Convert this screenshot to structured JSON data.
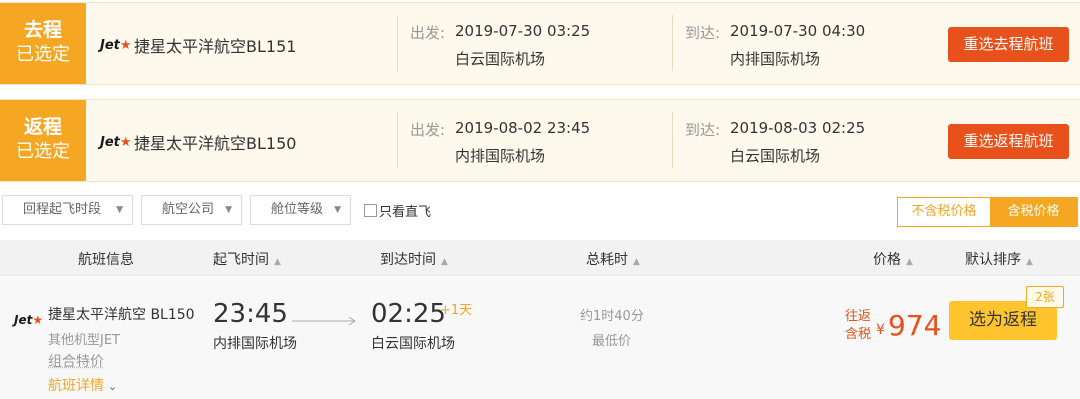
{
  "segments": [
    {
      "tag_line1": "去程",
      "tag_line2": "已选定",
      "logo_text": "Jet",
      "logo_star": "★",
      "airline_flight": "捷星太平洋航空BL151",
      "dep_label": "出发:",
      "dep_time": "2019-07-30 03:25",
      "dep_airport": "白云国际机场",
      "arr_label": "到达:",
      "arr_time": "2019-07-30 04:30",
      "arr_airport": "内排国际机场",
      "reselect_label": "重选去程航班"
    },
    {
      "tag_line1": "返程",
      "tag_line2": "已选定",
      "logo_text": "Jet",
      "logo_star": "★",
      "airline_flight": "捷星太平洋航空BL150",
      "dep_label": "出发:",
      "dep_time": "2019-08-02 23:45",
      "dep_airport": "内排国际机场",
      "arr_label": "到达:",
      "arr_time": "2019-08-03 02:25",
      "arr_airport": "白云国际机场",
      "reselect_label": "重选返程航班"
    }
  ],
  "filters": {
    "time_segment": "回程起飞时段",
    "airline": "航空公司",
    "cabin": "舱位等级",
    "direct_only": "只看直飞",
    "tax_excluded": "不含税价格",
    "tax_included": "含税价格"
  },
  "table_headers": {
    "flight_info": "航班信息",
    "dep_time": "起飞时间",
    "arr_time": "到达时间",
    "duration": "总耗时",
    "price": "价格",
    "default_sort": "默认排序"
  },
  "flight_row": {
    "logo_text": "Jet",
    "logo_star": "★",
    "airline": "捷星太平洋航空 BL150",
    "plane": "其他机型JET",
    "combo": "组合特价",
    "details": "航班详情",
    "dep_time": "23:45",
    "dep_airport": "内排国际机场",
    "arr_time": "02:25",
    "plus_day": "+1天",
    "arr_airport": "白云国际机场",
    "duration": "约1时40分",
    "cheapest": "最低价",
    "price_label1": "往返",
    "price_label2": "含税",
    "currency": "¥",
    "price": "974",
    "choose_label": "选为返程",
    "tickets_left": "2张"
  },
  "colors": {
    "accent_orange": "#f5a623",
    "action_red": "#e8501c",
    "choose_yellow": "#ffc42e"
  }
}
